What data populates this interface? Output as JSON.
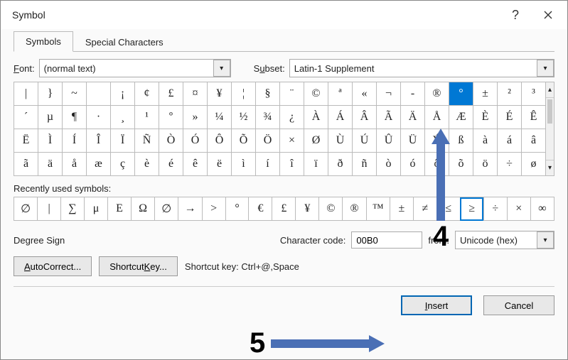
{
  "title": "Symbol",
  "tabs": {
    "symbols": "Symbols",
    "special": "Special Characters"
  },
  "font": {
    "label": "Font:",
    "value": "(normal text)"
  },
  "subset": {
    "label": "Subset:",
    "value": "Latin-1 Supplement"
  },
  "grid": {
    "rows": [
      [
        "|",
        "}",
        "~",
        " ",
        "¡",
        "¢",
        "£",
        "¤",
        "¥",
        "¦",
        "§",
        "¨",
        "©",
        "ª",
        "«",
        "¬",
        "­-",
        "®",
        "°",
        "±",
        "²",
        "³"
      ],
      [
        "´",
        "µ",
        "¶",
        "·",
        "¸",
        "¹",
        "º",
        "»",
        "¼",
        "½",
        "¾",
        "¿",
        "À",
        "Á",
        "Â",
        "Ã",
        "Ä",
        "Å",
        "Æ",
        "È",
        "É",
        "Ê"
      ],
      [
        "Ë",
        "Ì",
        "Í",
        "Î",
        "Ï",
        "Ñ",
        "Ò",
        "Ó",
        "Ô",
        "Õ",
        "Ö",
        "×",
        "Ø",
        "Ù",
        "Ú",
        "Û",
        "Ü",
        "Ý",
        "ß",
        "à",
        "á",
        "â"
      ],
      [
        "ã",
        "ä",
        "å",
        "æ",
        "ç",
        "è",
        "é",
        "ê",
        "ë",
        "ì",
        "í",
        "î",
        "ï",
        "ð",
        "ñ",
        "ò",
        "ó",
        "ô",
        "õ",
        "ö",
        "÷",
        "ø"
      ]
    ],
    "selected": {
      "row": 0,
      "col": 18
    }
  },
  "recent_label": "Recently used symbols:",
  "recent": [
    "∅",
    "|",
    "∑",
    "μ",
    "Ε",
    "Ω",
    "∅",
    "→",
    ">",
    "°",
    "€",
    "£",
    "¥",
    "©",
    "®",
    "™",
    "±",
    "≠",
    "≤",
    "≥",
    "÷",
    "×",
    "∞"
  ],
  "recent_selected": 19,
  "symbol_name": "Degree Sign",
  "charcode": {
    "label": "Character code:",
    "value": "00B0"
  },
  "from": {
    "label": "from:",
    "value": "Unicode (hex)"
  },
  "buttons": {
    "autocorrect": "AutoCorrect...",
    "shortcutkey": "Shortcut Key...",
    "shortcut_label": "Shortcut key:",
    "shortcut_value": "Ctrl+@,Space",
    "insert": "Insert",
    "cancel": "Cancel"
  },
  "annotations": {
    "step4": "4",
    "step5": "5"
  }
}
